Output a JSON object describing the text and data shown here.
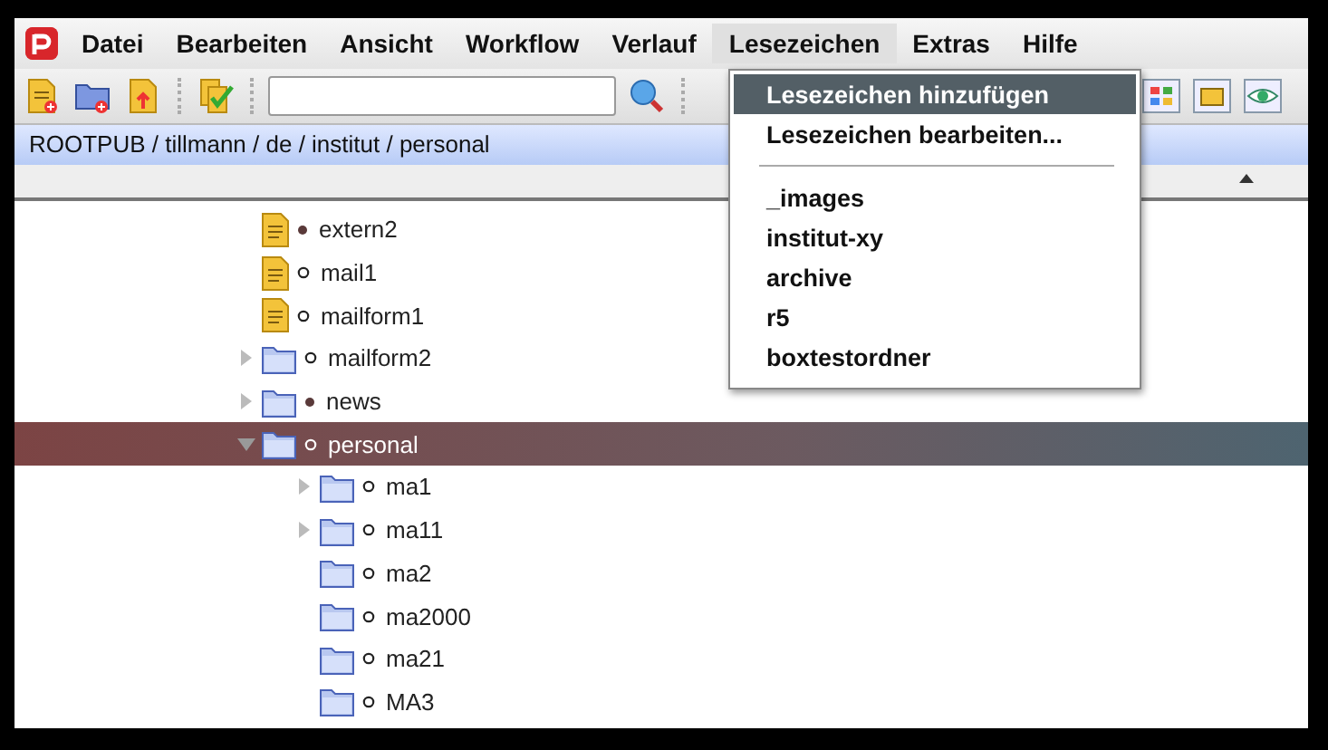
{
  "menu_bar": {
    "items": [
      {
        "label": "Datei",
        "selected": false
      },
      {
        "label": "Bearbeiten",
        "selected": false
      },
      {
        "label": "Ansicht",
        "selected": false
      },
      {
        "label": "Workflow",
        "selected": false
      },
      {
        "label": "Verlauf",
        "selected": false
      },
      {
        "label": "Lesezeichen",
        "selected": true
      },
      {
        "label": "Extras",
        "selected": false
      },
      {
        "label": "Hilfe",
        "selected": false
      }
    ]
  },
  "breadcrumb": "ROOTPUB / tillmann / de / institut / personal",
  "tree": [
    {
      "label": "extern2",
      "kind": "file",
      "filled": true,
      "expandable": false,
      "selected": false
    },
    {
      "label": "mail1",
      "kind": "file",
      "filled": false,
      "expandable": false,
      "selected": false
    },
    {
      "label": "mailform1",
      "kind": "file",
      "filled": false,
      "expandable": false,
      "selected": false
    },
    {
      "label": "mailform2",
      "kind": "folder",
      "filled": false,
      "expandable": true,
      "expanded": false,
      "selected": false
    },
    {
      "label": "news",
      "kind": "folder",
      "filled": true,
      "expandable": true,
      "expanded": false,
      "selected": false
    },
    {
      "label": "personal",
      "kind": "folder",
      "filled": false,
      "expandable": true,
      "expanded": true,
      "selected": true,
      "children": [
        {
          "label": "ma1",
          "kind": "folder",
          "filled": false,
          "expandable": true,
          "expanded": false,
          "selected": false
        },
        {
          "label": "ma11",
          "kind": "folder",
          "filled": false,
          "expandable": true,
          "expanded": false,
          "selected": false
        },
        {
          "label": "ma2",
          "kind": "folder",
          "filled": false,
          "expandable": false,
          "selected": false
        },
        {
          "label": "ma2000",
          "kind": "folder",
          "filled": false,
          "expandable": false,
          "selected": false
        },
        {
          "label": "ma21",
          "kind": "folder",
          "filled": false,
          "expandable": false,
          "selected": false
        },
        {
          "label": "MA3",
          "kind": "folder",
          "filled": false,
          "expandable": false,
          "selected": false
        }
      ]
    }
  ],
  "bookmarks_menu": {
    "items": [
      {
        "label": "Lesezeichen hinzufügen",
        "selected": true
      },
      {
        "label": "Lesezeichen bearbeiten...",
        "selected": false
      },
      {
        "kind": "separator"
      },
      {
        "label": "_images",
        "selected": false
      },
      {
        "label": "institut-xy",
        "selected": false
      },
      {
        "label": "archive",
        "selected": false
      },
      {
        "label": "r5",
        "selected": false
      },
      {
        "label": "boxtestordner",
        "selected": false
      }
    ]
  }
}
